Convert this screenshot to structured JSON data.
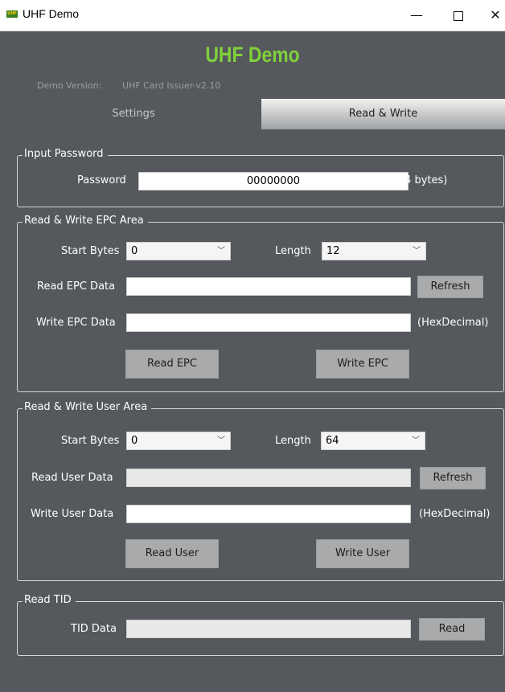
{
  "window": {
    "title": "UHF Demo",
    "logo_text": "UHF",
    "minimize": "—",
    "close": "✕"
  },
  "header": {
    "app_title": "UHF Demo",
    "version_label": "Demo Version:",
    "version_value": "UHF Card Issuer-v2.10"
  },
  "tabs": [
    {
      "label": "Settings",
      "active": false
    },
    {
      "label": "Read & Write",
      "active": true
    }
  ],
  "password_group": {
    "legend": "Input Password",
    "label": "Password",
    "value": "00000000",
    "hint": "(4 bytes)"
  },
  "epc_group": {
    "legend": "Read & Write EPC Area",
    "start_label": "Start Bytes",
    "start_value": "0",
    "length_label": "Length",
    "length_value": "12",
    "read_label": "Read EPC Data",
    "read_value": "",
    "refresh_label": "Refresh",
    "write_label": "Write EPC Data",
    "write_value": "",
    "write_hint": "(HexDecimal)",
    "read_button": "Read EPC",
    "write_button": "Write EPC"
  },
  "user_group": {
    "legend": "Read & Write User Area",
    "start_label": "Start Bytes",
    "start_value": "0",
    "length_label": "Length",
    "length_value": "64",
    "read_label": "Read User Data",
    "read_value": "",
    "refresh_label": "Refresh",
    "write_label": "Write User Data",
    "write_value": "",
    "write_hint": "(HexDecimal)",
    "read_button": "Read User",
    "write_button": "Write User"
  },
  "tid_group": {
    "legend": "Read TID",
    "label": "TID Data",
    "value": "",
    "read_button": "Read"
  },
  "colors": {
    "background": "#55585c",
    "title_green": "#7fd13b",
    "button_gray": "#a9aaab"
  }
}
